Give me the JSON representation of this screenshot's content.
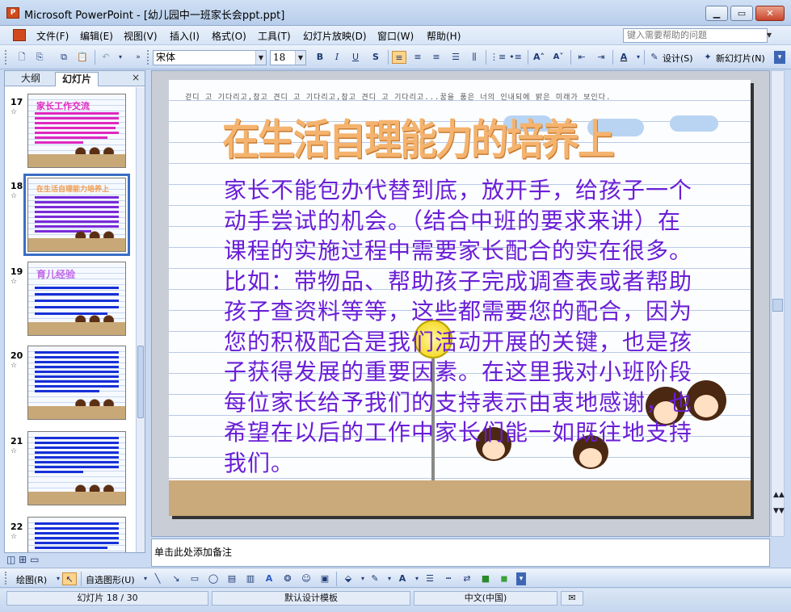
{
  "window": {
    "app_icon": "P",
    "title": "Microsoft PowerPoint - [幼儿园中一班家长会ppt.ppt]",
    "min": "▁",
    "restore": "▭",
    "close": "✕"
  },
  "menu": {
    "items": [
      "文件(F)",
      "编辑(E)",
      "视图(V)",
      "插入(I)",
      "格式(O)",
      "工具(T)",
      "幻灯片放映(D)",
      "窗口(W)",
      "帮助(H)"
    ],
    "help_placeholder": "键入需要帮助的问题"
  },
  "toolbar": {
    "font_name": "宋体",
    "font_size": "18",
    "bold": "B",
    "italic": "I",
    "underline": "U",
    "shadow": "S",
    "design_label": "设计(S)",
    "new_slide_label": "新幻灯片(N)"
  },
  "left_pane": {
    "tabs": [
      "大纲",
      "幻灯片"
    ],
    "close": "×",
    "slides": [
      {
        "num": "17",
        "title": "家长工作交流"
      },
      {
        "num": "18",
        "title": "在生活自理能力培养上"
      },
      {
        "num": "19",
        "title": "育儿经验"
      },
      {
        "num": "20",
        "title": ""
      },
      {
        "num": "21",
        "title": ""
      },
      {
        "num": "22",
        "title": ""
      }
    ],
    "star": "☆"
  },
  "slide": {
    "header_text": "걷디 고 기다리고,참고 견디 고 기다리고,참고 견디 고 기다리고...꿈을 품은 너의 인내되에 밝은 미래가 보인다.",
    "title": "在生活自理能力的培养上",
    "body": "家长不能包办代替到底，放开手，给孩子一个动手尝试的机会。（结合中班的要求来讲）在课程的实施过程中需要家长配合的实在很多。比如：带物品、帮助孩子完成调查表或者帮助孩子查资料等等，这些都需要您的配合，因为您的积极配合是我们活动开展的关键，也是孩子获得发展的重要因素。在这里我对小班阶段每位家长给予我们的支持表示由衷地感谢，也希望在以后的工作中家长们能一如既往地支持我们。"
  },
  "notes": {
    "placeholder": "单击此处添加备注"
  },
  "drawbar": {
    "draw_label": "绘图(R)",
    "autoshape_label": "自选图形(U)"
  },
  "status": {
    "slide_pos": "幻灯片 18 / 30",
    "template": "默认设计模板",
    "language": "中文(中国)"
  }
}
